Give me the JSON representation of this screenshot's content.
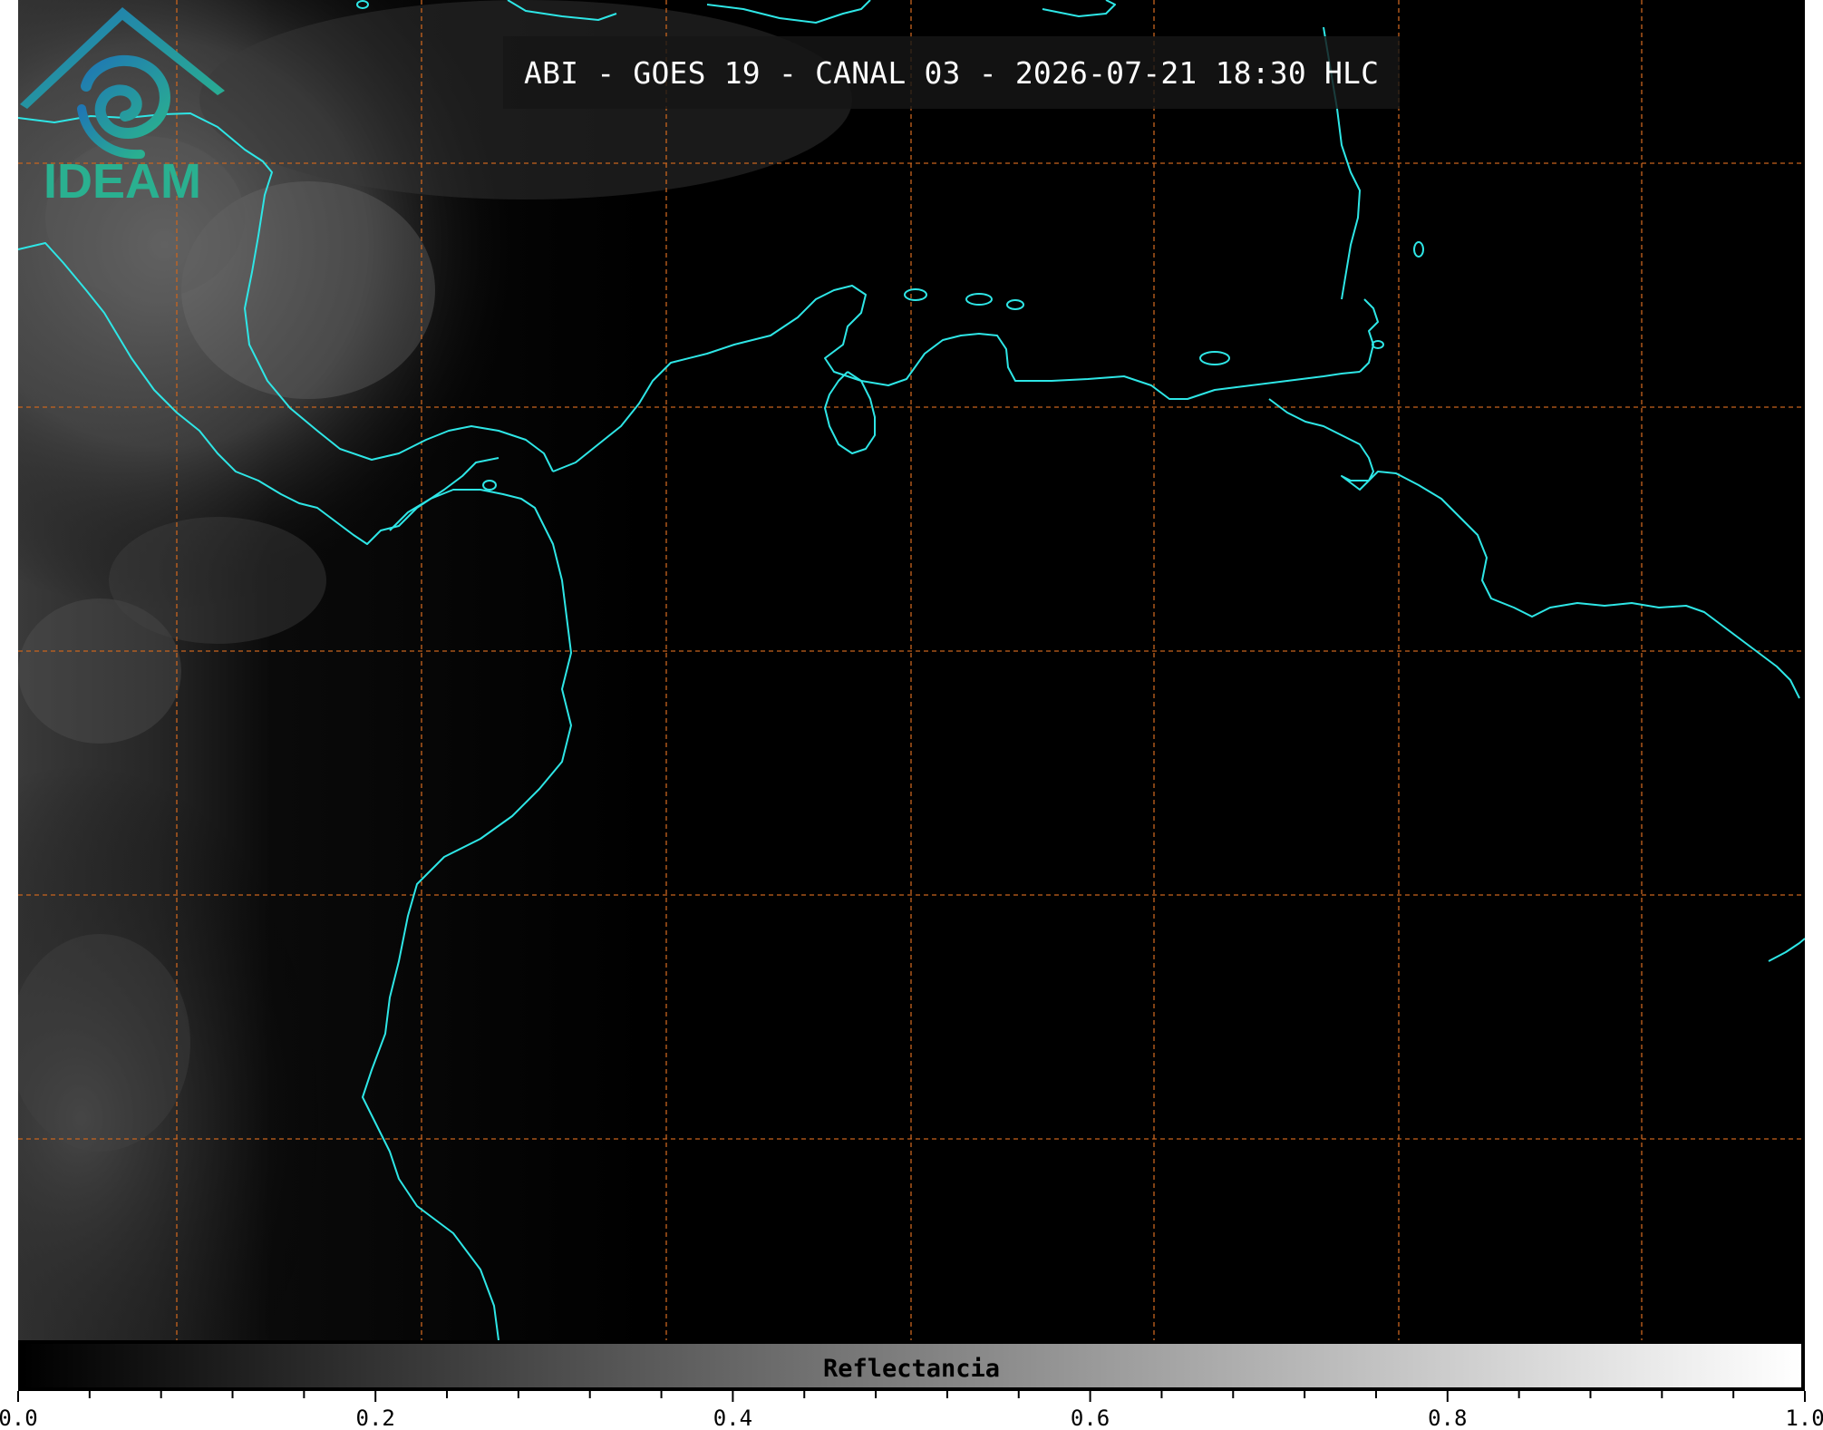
{
  "title": "ABI - GOES 19 - CANAL 03 - 2026-07-21 18:30 HLC",
  "colorbar": {
    "label": "Reflectancia",
    "range": [
      0.0,
      1.0
    ],
    "tick_labels": [
      "0.0",
      "0.2",
      "0.4",
      "0.6",
      "0.8",
      "1.0"
    ],
    "minor_ticks_per_major": 4,
    "colormap": "grayscale black-to-white"
  },
  "map": {
    "coastline_color": "#2ee6e6",
    "gridline_color": "#c8641e",
    "gridline_style": "dashed",
    "background": "#000000"
  },
  "logo": {
    "text": "IDEAM",
    "colors": [
      "#1f77b4",
      "#2ab090"
    ]
  }
}
